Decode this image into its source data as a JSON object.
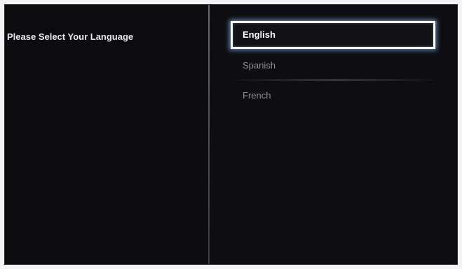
{
  "prompt": {
    "text": "Please Select Your Language"
  },
  "languages": {
    "items": [
      {
        "label": "English",
        "selected": true
      },
      {
        "label": "Spanish",
        "selected": false
      },
      {
        "label": "French",
        "selected": false
      }
    ]
  },
  "colors": {
    "background": "#0d0d10",
    "selected_text": "#ffffff",
    "unselected_text": "#8c8c94",
    "focus_glow": "#8cbeff"
  }
}
